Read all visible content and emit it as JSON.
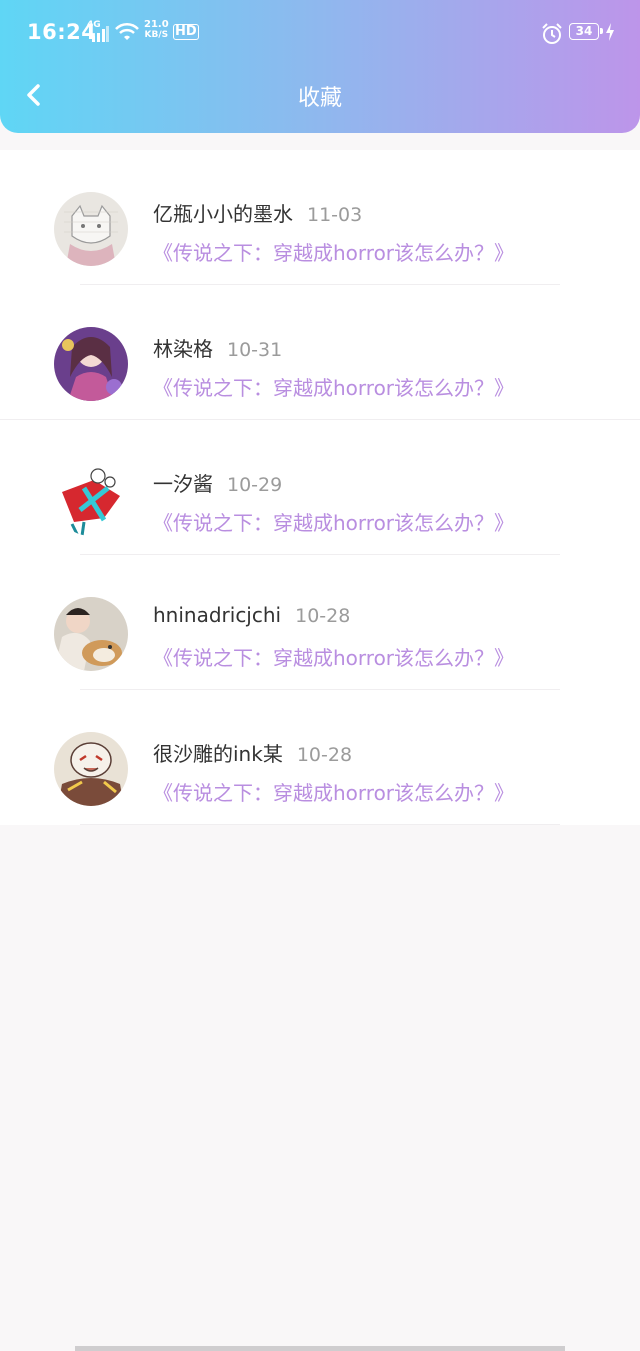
{
  "status_bar": {
    "time": "16:24",
    "network": "4G",
    "speed_value": "21.0",
    "speed_unit": "KB/S",
    "hd": "HD",
    "battery": "34",
    "icons": [
      "signal-icon",
      "wifi-icon",
      "alarm-icon",
      "battery-icon",
      "charging-icon"
    ]
  },
  "header": {
    "title": "收藏",
    "back_icon": "chevron-left-icon"
  },
  "colors": {
    "gradient_start": "#5fd6f5",
    "gradient_end": "#bd95ea",
    "work_title": "#b98ee0",
    "date": "#9b9b9b"
  },
  "favorites": [
    {
      "user": "亿瓶小小的墨水",
      "date": "11-03",
      "work": "《传说之下：穿越成horror该怎么办？》"
    },
    {
      "user": "林染格",
      "date": "10-31",
      "work": "《传说之下：穿越成horror该怎么办？》"
    },
    {
      "user": "一汐酱",
      "date": "10-29",
      "work": "《传说之下：穿越成horror该怎么办？》"
    },
    {
      "user": "hninadricjchi",
      "date": "10-28",
      "work": "《传说之下：穿越成horror该怎么办？》"
    },
    {
      "user": "很沙雕的ink某",
      "date": "10-28",
      "work": "《传说之下：穿越成horror该怎么办？》"
    }
  ]
}
